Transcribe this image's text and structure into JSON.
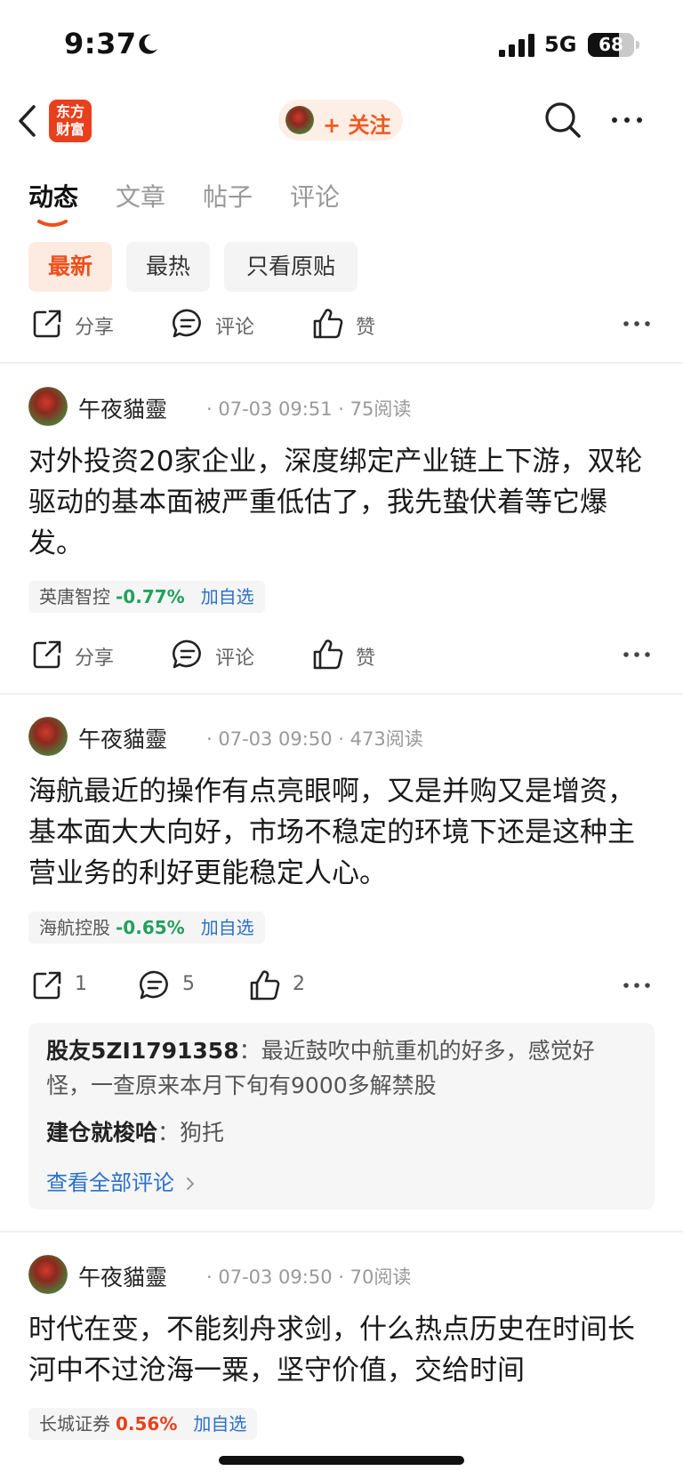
{
  "status_bar": {
    "time": "9:37",
    "network": "5G",
    "battery": "68",
    "battery_level": 0.68
  },
  "header": {
    "logo_text": "东方财富",
    "follow_label": "+ 关注"
  },
  "tabs": [
    {
      "label": "动态",
      "active": true
    },
    {
      "label": "文章",
      "active": false
    },
    {
      "label": "帖子",
      "active": false
    },
    {
      "label": "评论",
      "active": false
    }
  ],
  "filters": [
    {
      "label": "最新",
      "active": true
    },
    {
      "label": "最热",
      "active": false
    },
    {
      "label": "只看原贴",
      "active": false
    }
  ],
  "top_actions": {
    "share": "分享",
    "comment": "评论",
    "like": "赞"
  },
  "posts": [
    {
      "author": "午夜貓靈",
      "time": "07-03 09:51",
      "reads": "75阅读",
      "body": "对外投资20家企业，深度绑定产业链上下游，双轮驱动的基本面被严重低估了，我先蛰伏着等它爆发。",
      "stock": {
        "name": "英唐智控",
        "change": "-0.77%",
        "direction": "down",
        "add": "加自选"
      },
      "actions": {
        "share": "分享",
        "comment": "评论",
        "like": "赞"
      }
    },
    {
      "author": "午夜貓靈",
      "time": "07-03 09:50",
      "reads": "473阅读",
      "body": "海航最近的操作有点亮眼啊，又是并购又是增资，基本面大大向好，市场不稳定的环境下还是这种主营业务的利好更能稳定人心。",
      "stock": {
        "name": "海航控股",
        "change": "-0.65%",
        "direction": "down",
        "add": "加自选"
      },
      "actions": {
        "share": "1",
        "comment": "5",
        "like": "2"
      },
      "comments": [
        {
          "user": "股友5ZI1791358",
          "text": "最近鼓吹中航重机的好多，感觉好怪，一查原来本月下旬有9000多解禁股"
        },
        {
          "user": "建仓就梭哈",
          "text": "狗托"
        }
      ],
      "view_all": "查看全部评论"
    },
    {
      "author": "午夜貓靈",
      "time": "07-03 09:50",
      "reads": "70阅读",
      "body": "时代在变，不能刻舟求剑，什么热点历史在时间长河中不过沧海一粟，坚守价值，交给时间",
      "stock": {
        "name": "长城证券",
        "change": "0.56%",
        "direction": "up",
        "add": "加自选"
      },
      "actions": {
        "share": "分享",
        "comment": "评论",
        "like": "赞"
      }
    }
  ],
  "colors": {
    "accent": "#ef4f1c",
    "down": "#22a05e",
    "up": "#e8401c",
    "link": "#2a71c9"
  }
}
